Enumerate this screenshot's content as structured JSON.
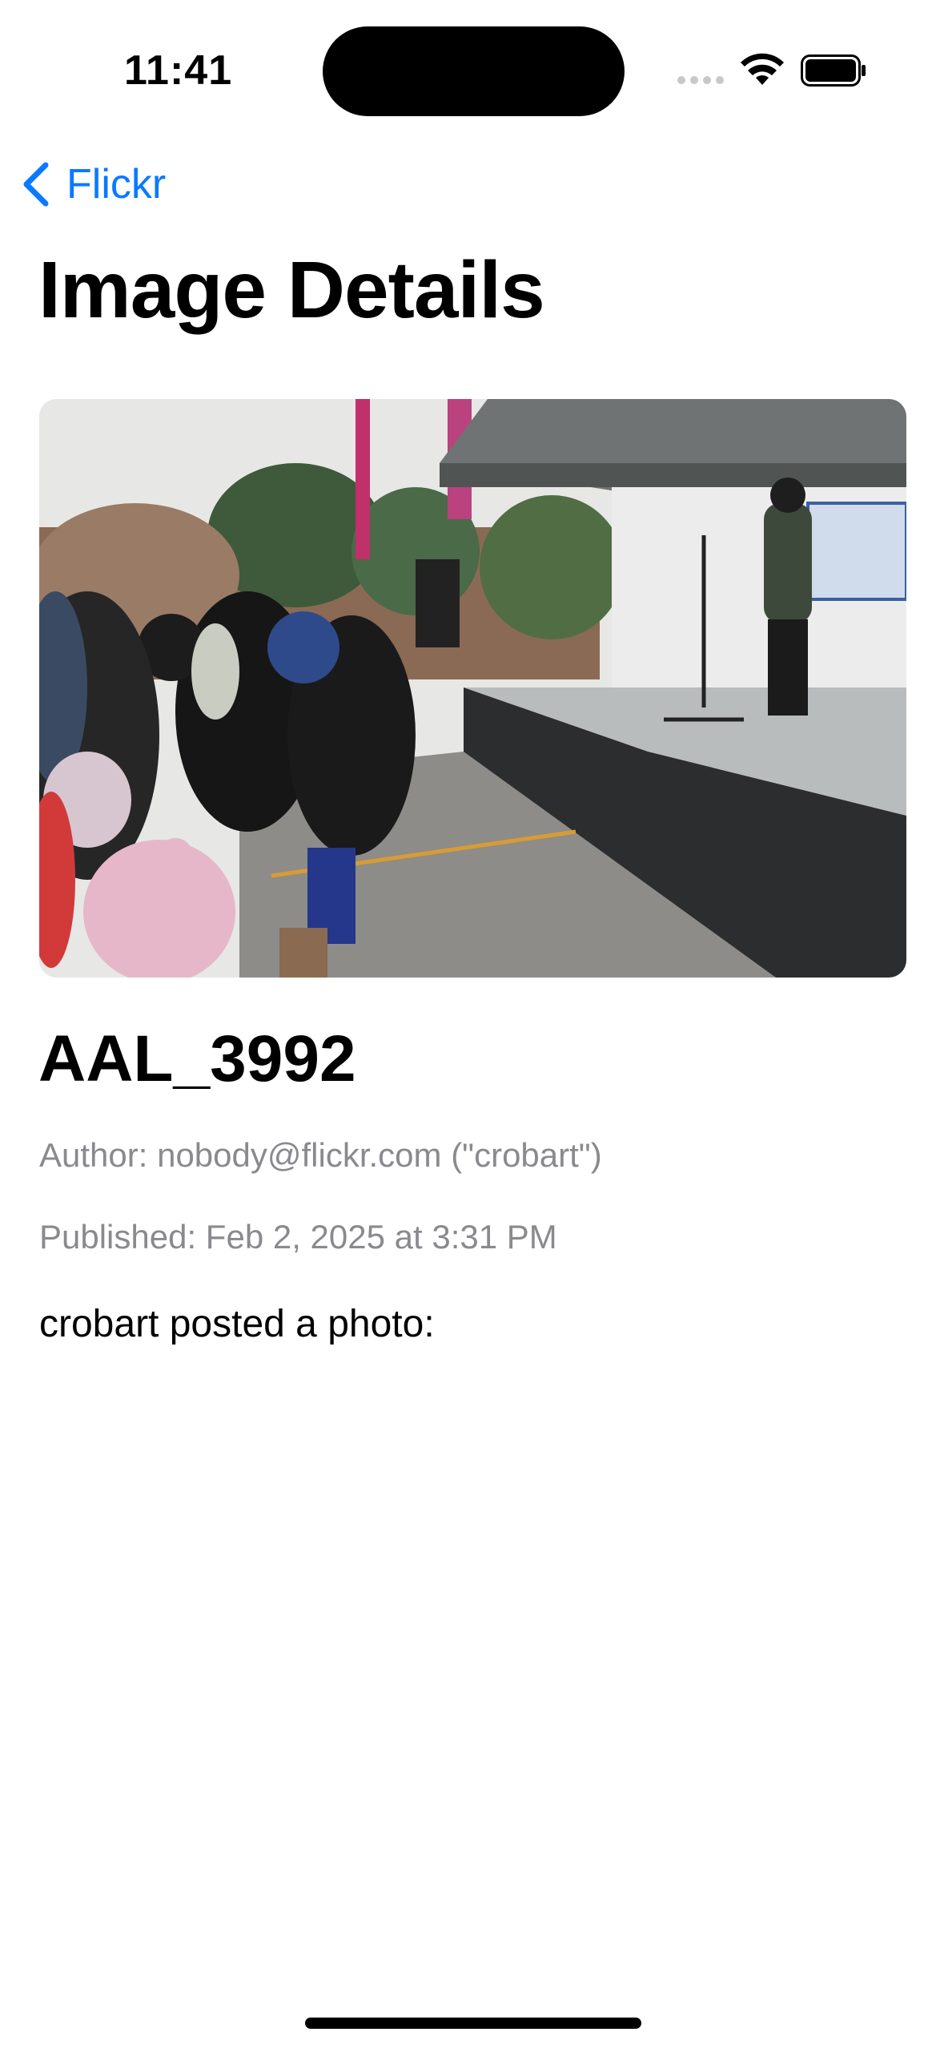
{
  "status_bar": {
    "time": "11:41"
  },
  "nav": {
    "back_label": "Flickr",
    "back_icon": "chevron-left-icon"
  },
  "page": {
    "title": "Image Details"
  },
  "photo": {
    "subject": "outdoor winter event, crowd facing a stage with a performer at a microphone"
  },
  "details": {
    "title": "AAL_3992",
    "author": "Author: nobody@flickr.com (\"crobart\")",
    "published": "Published: Feb 2, 2025 at 3:31 PM",
    "description": "crobart posted a photo:"
  },
  "colors": {
    "accent": "#0a7aff",
    "secondary_text": "#8a8a8e"
  }
}
